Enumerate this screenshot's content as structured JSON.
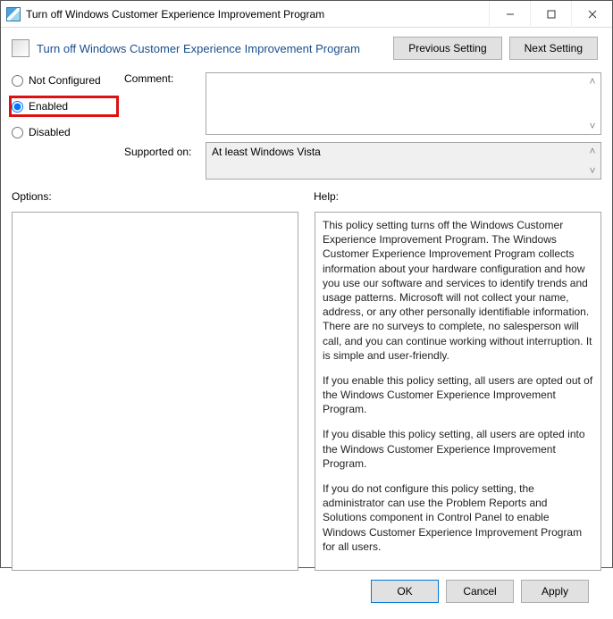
{
  "window": {
    "title": "Turn off Windows Customer Experience Improvement Program"
  },
  "header": {
    "title": "Turn off Windows Customer Experience Improvement Program",
    "previous": "Previous Setting",
    "next": "Next Setting"
  },
  "state": {
    "comment_label": "Comment:",
    "supported_label": "Supported on:",
    "supported_value": "At least Windows Vista",
    "options_label": "Options:",
    "help_label": "Help:"
  },
  "radios": {
    "not_configured": "Not Configured",
    "enabled": "Enabled",
    "disabled": "Disabled",
    "selected": "enabled"
  },
  "help": {
    "p1": "This policy setting turns off the Windows Customer Experience Improvement Program. The Windows Customer Experience Improvement Program collects information about your hardware configuration and how you use our software and services to identify trends and usage patterns. Microsoft will not collect your name, address, or any other personally identifiable information. There are no surveys to complete, no salesperson will call, and you can continue working without interruption. It is simple and user-friendly.",
    "p2": "If you enable this policy setting, all users are opted out of the Windows Customer Experience Improvement Program.",
    "p3": "If you disable this policy setting, all users are opted into the Windows Customer Experience Improvement Program.",
    "p4": "If you do not configure this policy setting, the administrator can use the Problem Reports and Solutions component in Control Panel to enable Windows Customer Experience Improvement Program for all users."
  },
  "footer": {
    "ok": "OK",
    "cancel": "Cancel",
    "apply": "Apply"
  }
}
